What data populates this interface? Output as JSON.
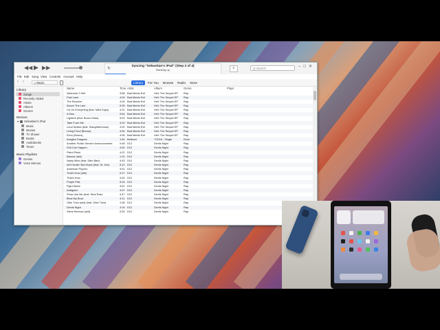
{
  "topbar": {
    "rewind_icon": "rewind-icon",
    "play_icon": "play-icon",
    "forward_icon": "fast-forward-icon",
    "sync_title": "Syncing \"Sebastian's iPad\" (Step 2 of 4)",
    "sync_status": "Backing up",
    "search_placeholder": "Q Search"
  },
  "menus": [
    "File",
    "Edit",
    "Song",
    "View",
    "Controls",
    "Account",
    "Help"
  ],
  "nav": {
    "media": "Music",
    "tabs": [
      {
        "label": "Library",
        "active": true
      },
      {
        "label": "For You",
        "active": false
      },
      {
        "label": "Browse",
        "active": false
      },
      {
        "label": "Radio",
        "active": false
      },
      {
        "label": "Store",
        "active": false
      }
    ]
  },
  "sidebar": {
    "library_header": "Library",
    "library_items": [
      "Songs",
      "Recently Added",
      "Artists",
      "Albums",
      "Genres"
    ],
    "devices_header": "Devices",
    "device_name": "Sebastian's iPad",
    "device_items": [
      "Music",
      "Movies",
      "TV Shows",
      "Books",
      "Audiobooks",
      "Tones"
    ],
    "playlists_header": "Music Playlists",
    "playlist_items": [
      "Genius",
      "Voice Memos"
    ]
  },
  "table": {
    "columns": [
      "Name",
      "Time",
      "Artist",
      "Album",
      "Genre",
      "Plays"
    ],
    "rows": [
      [
        "Welcome 2 Hell",
        "3:58",
        "Bad Meets Evil",
        "Hell: The Sequel EP",
        "Rap"
      ],
      [
        "Fast Lane",
        "4:09",
        "Bad Meets Evil",
        "Hell: The Sequel EP",
        "Rap"
      ],
      [
        "The Reunion",
        "4:04",
        "Bad Meets Evil",
        "Hell: The Sequel EP",
        "Rap"
      ],
      [
        "Above The Law",
        "5:35",
        "Bad Meets Evil",
        "Hell: The Sequel EP",
        "Rap"
      ],
      [
        "I'm On Everything (feat. Mike Epps)",
        "4:31",
        "Bad Meets Evil",
        "Hell: The Sequel EP",
        "Rap"
      ],
      [
        "A Kiss",
        "5:54",
        "Bad Meets Evil",
        "Hell: The Sequel EP",
        "Rap"
      ],
      [
        "Lighters (feat. Bruno Mars)",
        "5:03",
        "Bad Meets Evil",
        "Hell: The Sequel EP",
        "Rap"
      ],
      [
        "Take From Me",
        "4:29",
        "Bad Meets Evil",
        "Hell: The Sequel EP",
        "Rap"
      ],
      [
        "Loud Noises (feat. Slaughterhouse)",
        "4:20",
        "Bad Meets Evil",
        "Hell: The Sequel EP",
        "Rap"
      ],
      [
        "Living Proof (Bonus)",
        "4:50",
        "Bad Meets Evil",
        "Hell: The Sequel EP",
        "Rap"
      ],
      [
        "Echo (Bonus)",
        "4:55",
        "Bad Meets Evil",
        "Hell: The Sequel EP",
        "Rap"
      ],
      [
        "Imagine Dragons",
        "1:54",
        "Believer",
        "7/2018 - Single",
        "Rock"
      ],
      [
        "Another Public Service Announcement",
        "0:48",
        "D12",
        "Devils Night",
        "Rap"
      ],
      [
        "Shit Can Happen",
        "4:52",
        "D12",
        "Devils Night",
        "Rap"
      ],
      [
        "Pistol Pistol",
        "4:22",
        "D12",
        "Devils Night",
        "Rap"
      ],
      [
        "Bizarre (skit)",
        "1:10",
        "D12",
        "Devils Night",
        "Rap"
      ],
      [
        "Nasty Mind (feat. Ditto Bad)",
        "4:43",
        "D12",
        "Devils Night",
        "Rap"
      ],
      [
        "Ain't Nuttin' But Music (feat. Dr. Dre)",
        "5:12",
        "D12",
        "Devils Night",
        "Rap"
      ],
      [
        "American Psycho",
        "4:51",
        "D12",
        "Devils Night",
        "Rap"
      ],
      [
        "That's How (skit)",
        "0:27",
        "D12",
        "Devils Night",
        "Rap"
      ],
      [
        "That's How...",
        "4:49",
        "D12",
        "Devils Night",
        "Rap"
      ],
      [
        "Purple Pills",
        "5:04",
        "D12",
        "Devils Night",
        "Rap"
      ],
      [
        "Fight Music",
        "4:51",
        "D12",
        "Devils Night",
        "Rap"
      ],
      [
        "Instigator",
        "4:07",
        "D12",
        "Devils Night",
        "Rap"
      ],
      [
        "Pimp Like Me (feat. Dina Rae)",
        "4:47",
        "D12",
        "Devils Night",
        "Rap"
      ],
      [
        "Blow My Buzz",
        "4:11",
        "D12",
        "Devils Night",
        "Rap"
      ],
      [
        "Obie Trice (skit) (feat. Obie Trice)",
        "1:08",
        "D12",
        "Devils Night",
        "Rap"
      ],
      [
        "Devils Night",
        "4:19",
        "D12",
        "Devils Night",
        "Rap"
      ],
      [
        "Steve Berman (skit)",
        "0:53",
        "D12",
        "Devils Night",
        "Rap"
      ]
    ]
  },
  "colors": {
    "accent": "#2a6fe0"
  }
}
